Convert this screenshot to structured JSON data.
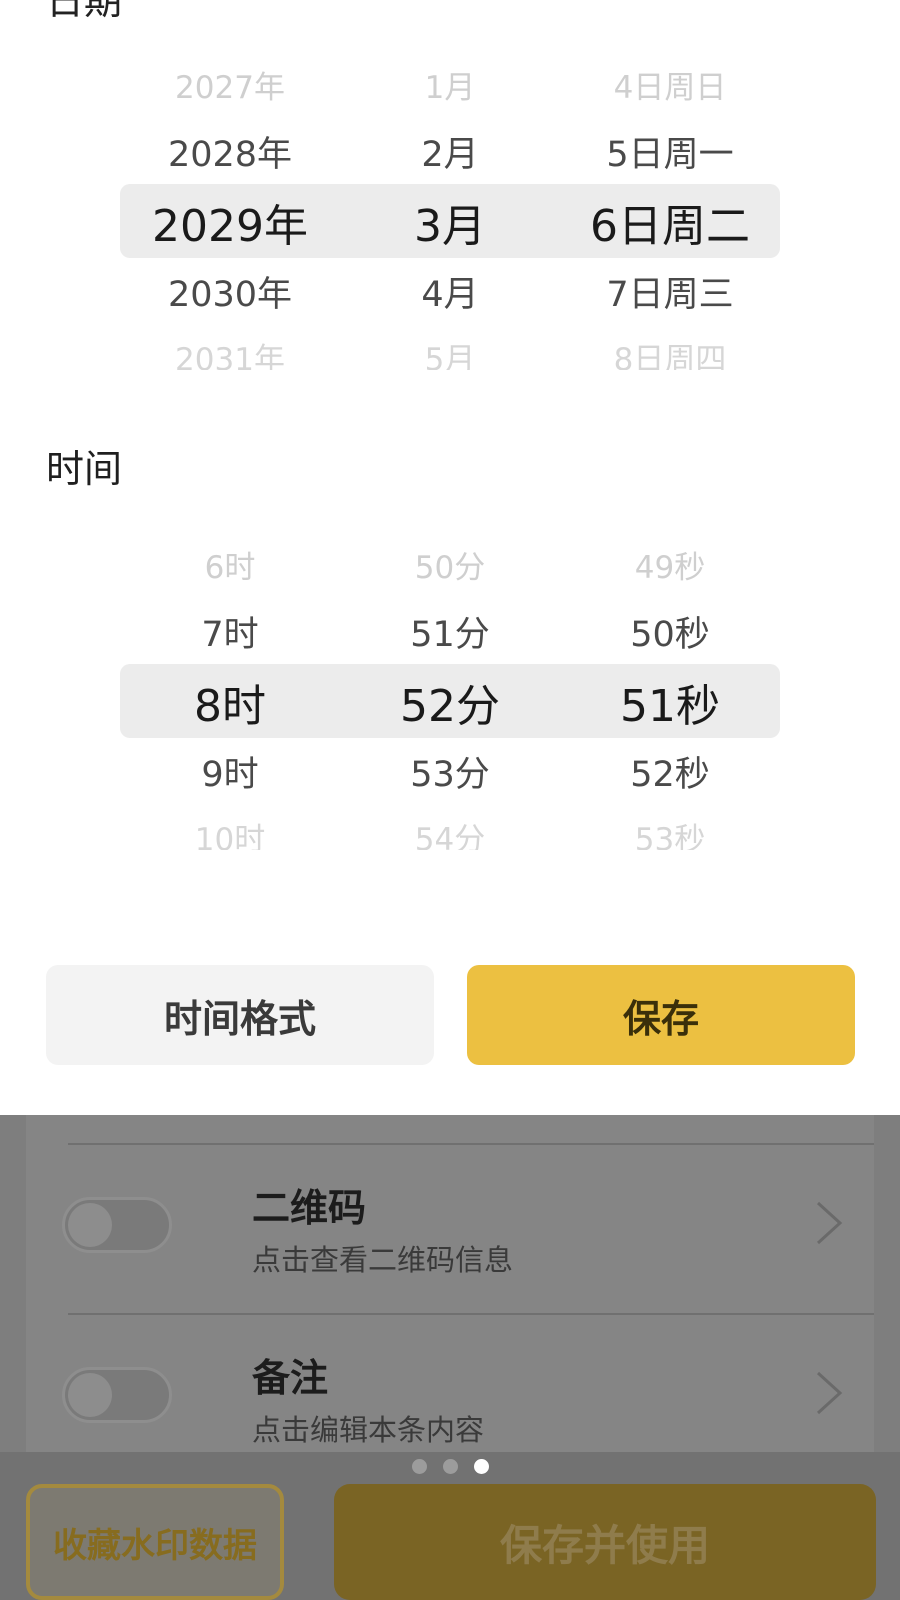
{
  "top_label_fragment": "日期",
  "date_picker": {
    "years": [
      "2027年",
      "2028年",
      "2029年",
      "2030年",
      "2031年"
    ],
    "months": [
      "1月",
      "2月",
      "3月",
      "4月",
      "5月"
    ],
    "days": [
      "4日周日",
      "5日周一",
      "6日周二",
      "7日周三",
      "8日周四"
    ],
    "selected": {
      "year": "2029年",
      "month": "3月",
      "day": "6日周二"
    }
  },
  "time_section": {
    "title": "时间",
    "hours": [
      "6时",
      "7时",
      "8时",
      "9时",
      "10时"
    ],
    "minutes": [
      "50分",
      "51分",
      "52分",
      "53分",
      "54分"
    ],
    "seconds": [
      "49秒",
      "50秒",
      "51秒",
      "52秒",
      "53秒"
    ],
    "selected": {
      "hour": "8时",
      "minute": "52分",
      "second": "51秒"
    }
  },
  "actions": {
    "format_label": "时间格式",
    "save_label": "保存"
  },
  "settings": [
    {
      "title": "二维码",
      "subtitle": "点击查看二维码信息",
      "enabled": false
    },
    {
      "title": "备注",
      "subtitle": "点击编辑本条内容",
      "enabled": false
    }
  ],
  "pager": {
    "count": 3,
    "active_index": 2
  },
  "bottom": {
    "collect_label": "收藏水印数据",
    "save_use_label": "保存并使用"
  },
  "colors": {
    "accent": "#ecc041",
    "highlight_band": "#ececec",
    "overlay": "#7e7e7e"
  }
}
